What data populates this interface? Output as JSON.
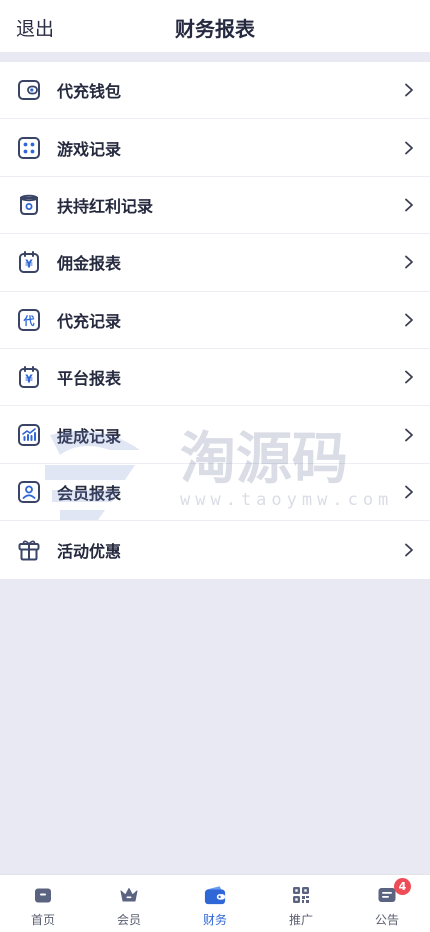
{
  "header": {
    "back_label": "退出",
    "title": "财务报表"
  },
  "menu": [
    {
      "label": "代充钱包",
      "icon": "wallet-icon"
    },
    {
      "label": "游戏记录",
      "icon": "dots-grid-icon"
    },
    {
      "label": "扶持红利记录",
      "icon": "cup-icon"
    },
    {
      "label": "佣金报表",
      "icon": "yen-calendar-icon"
    },
    {
      "label": "代充记录",
      "icon": "dai-badge-icon"
    },
    {
      "label": "平台报表",
      "icon": "yen-calendar-icon"
    },
    {
      "label": "提成记录",
      "icon": "chart-icon"
    },
    {
      "label": "会员报表",
      "icon": "user-card-icon"
    },
    {
      "label": "活动优惠",
      "icon": "gift-icon"
    }
  ],
  "dai_icon_text": "代",
  "yen_symbol": "¥",
  "watermark": {
    "text": "淘源码",
    "url": "www.taoymw.com"
  },
  "tabbar": [
    {
      "label": "首页",
      "icon": "home-icon",
      "active": false
    },
    {
      "label": "会员",
      "icon": "crown-icon",
      "active": false
    },
    {
      "label": "财务",
      "icon": "wallet-icon",
      "active": true
    },
    {
      "label": "推广",
      "icon": "qr-code-icon",
      "active": false
    },
    {
      "label": "公告",
      "icon": "notice-icon",
      "active": false,
      "badge": "4"
    }
  ],
  "colors": {
    "accent": "#2f67d6",
    "icon_dark": "#3a4466",
    "badge": "#ee4d57",
    "background": "#e8e9f2"
  }
}
